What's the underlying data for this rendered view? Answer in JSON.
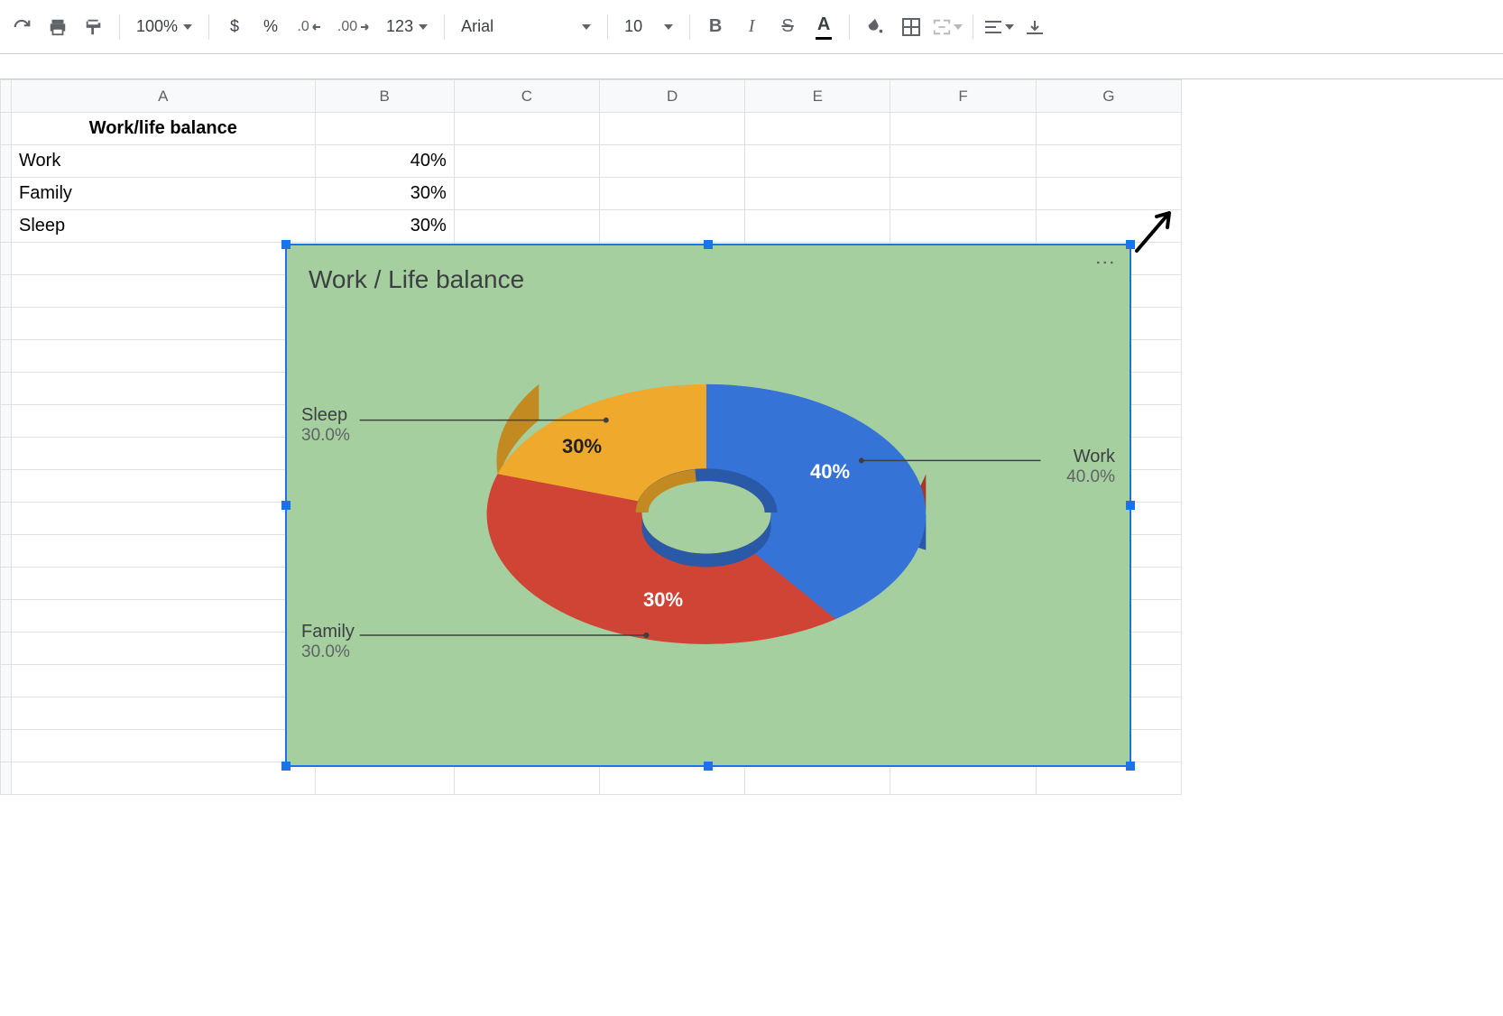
{
  "toolbar": {
    "zoom": "100%",
    "currency": "$",
    "percent": "%",
    "decrease_dec": ".0",
    "increase_dec": ".00",
    "format_more": "123",
    "font": "Arial",
    "font_size": "10",
    "bold": "B",
    "italic": "I",
    "strike": "S",
    "text_color": "A"
  },
  "columns": [
    "A",
    "B",
    "C",
    "D",
    "E",
    "F",
    "G"
  ],
  "sheet": {
    "title_cell": "Work/life balance",
    "rows": [
      {
        "label": "Work",
        "value": "40%"
      },
      {
        "label": "Family",
        "value": "30%"
      },
      {
        "label": "Sleep",
        "value": "30%"
      }
    ]
  },
  "chart_data": {
    "type": "pie",
    "title": "Work / Life balance",
    "hole": 0.28,
    "three_d": true,
    "series": [
      {
        "name": "Work",
        "value": 40,
        "label": "40%",
        "pct_text": "40.0%",
        "color": "#3573d6",
        "side": "#2a59a8"
      },
      {
        "name": "Family",
        "value": 30,
        "label": "30%",
        "pct_text": "30.0%",
        "color": "#d04436",
        "side": "#a8362b"
      },
      {
        "name": "Sleep",
        "value": 30,
        "label": "30%",
        "pct_text": "30.0%",
        "color": "#efa92c",
        "side": "#c48a22"
      }
    ],
    "background": "#a5cf9e"
  }
}
